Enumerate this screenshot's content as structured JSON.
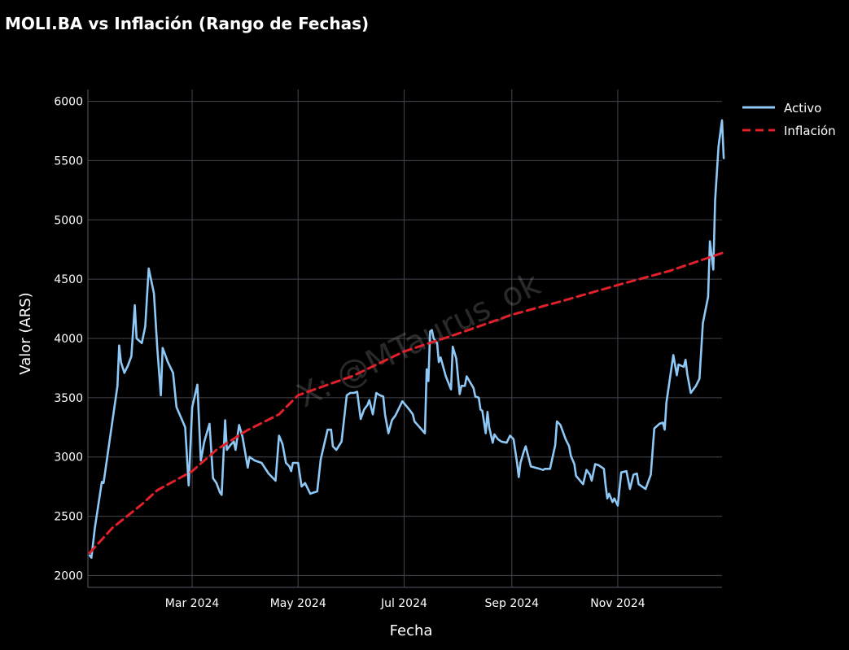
{
  "chart_data": {
    "type": "line",
    "title": "MOLI.BA vs Inflación (Rango de Fechas)",
    "xlabel": "Fecha",
    "ylabel": "Valor (ARS)",
    "xlim": [
      "2024-01-01",
      "2024-12-31"
    ],
    "ylim": [
      1900,
      6100
    ],
    "x_ticks": [
      {
        "date": "2024-03-01",
        "label": "Mar 2024"
      },
      {
        "date": "2024-05-01",
        "label": "May 2024"
      },
      {
        "date": "2024-07-01",
        "label": "Jul 2024"
      },
      {
        "date": "2024-09-01",
        "label": "Sep 2024"
      },
      {
        "date": "2024-11-01",
        "label": "Nov 2024"
      }
    ],
    "y_ticks": [
      2000,
      2500,
      3000,
      3500,
      4000,
      4500,
      5000,
      5500,
      6000
    ],
    "grid": true,
    "legend_position": "top-right",
    "watermark": "X: @MTaurus_ok",
    "series": [
      {
        "name": "Activo",
        "color": "#8ec8f6",
        "style": "solid",
        "points": [
          [
            "2024-01-02",
            2170
          ],
          [
            "2024-01-03",
            2150
          ],
          [
            "2024-01-05",
            2400
          ],
          [
            "2024-01-09",
            2790
          ],
          [
            "2024-01-10",
            2780
          ],
          [
            "2024-01-18",
            3600
          ],
          [
            "2024-01-19",
            3940
          ],
          [
            "2024-01-20",
            3800
          ],
          [
            "2024-01-22",
            3710
          ],
          [
            "2024-01-24",
            3770
          ],
          [
            "2024-01-26",
            3850
          ],
          [
            "2024-01-28",
            4280
          ],
          [
            "2024-01-29",
            4000
          ],
          [
            "2024-02-01",
            3960
          ],
          [
            "2024-02-03",
            4100
          ],
          [
            "2024-02-05",
            4590
          ],
          [
            "2024-02-08",
            4380
          ],
          [
            "2024-02-10",
            3900
          ],
          [
            "2024-02-12",
            3520
          ],
          [
            "2024-02-13",
            3920
          ],
          [
            "2024-02-16",
            3800
          ],
          [
            "2024-02-19",
            3710
          ],
          [
            "2024-02-21",
            3420
          ],
          [
            "2024-02-24",
            3320
          ],
          [
            "2024-02-26",
            3250
          ],
          [
            "2024-02-28",
            2760
          ],
          [
            "2024-03-01",
            3420
          ],
          [
            "2024-03-04",
            3610
          ],
          [
            "2024-03-06",
            2970
          ],
          [
            "2024-03-08",
            3130
          ],
          [
            "2024-03-11",
            3280
          ],
          [
            "2024-03-13",
            2820
          ],
          [
            "2024-03-15",
            2780
          ],
          [
            "2024-03-17",
            2700
          ],
          [
            "2024-03-18",
            2680
          ],
          [
            "2024-03-20",
            3310
          ],
          [
            "2024-03-21",
            3060
          ],
          [
            "2024-03-23",
            3100
          ],
          [
            "2024-03-25",
            3130
          ],
          [
            "2024-03-26",
            3060
          ],
          [
            "2024-03-28",
            3270
          ],
          [
            "2024-03-30",
            3170
          ],
          [
            "2024-04-02",
            2910
          ],
          [
            "2024-04-03",
            3000
          ],
          [
            "2024-04-06",
            2970
          ],
          [
            "2024-04-10",
            2950
          ],
          [
            "2024-04-14",
            2860
          ],
          [
            "2024-04-18",
            2800
          ],
          [
            "2024-04-20",
            3180
          ],
          [
            "2024-04-22",
            3110
          ],
          [
            "2024-04-24",
            2950
          ],
          [
            "2024-04-26",
            2920
          ],
          [
            "2024-04-27",
            2880
          ],
          [
            "2024-04-28",
            2950
          ],
          [
            "2024-05-01",
            2950
          ],
          [
            "2024-05-03",
            2750
          ],
          [
            "2024-05-05",
            2780
          ],
          [
            "2024-05-08",
            2690
          ],
          [
            "2024-05-10",
            2700
          ],
          [
            "2024-05-12",
            2710
          ],
          [
            "2024-05-14",
            2980
          ],
          [
            "2024-05-18",
            3230
          ],
          [
            "2024-05-20",
            3230
          ],
          [
            "2024-05-21",
            3090
          ],
          [
            "2024-05-23",
            3060
          ],
          [
            "2024-05-26",
            3130
          ],
          [
            "2024-05-29",
            3520
          ],
          [
            "2024-05-31",
            3540
          ],
          [
            "2024-06-02",
            3540
          ],
          [
            "2024-06-04",
            3550
          ],
          [
            "2024-06-06",
            3320
          ],
          [
            "2024-06-08",
            3400
          ],
          [
            "2024-06-10",
            3440
          ],
          [
            "2024-06-11",
            3480
          ],
          [
            "2024-06-13",
            3360
          ],
          [
            "2024-06-15",
            3540
          ],
          [
            "2024-06-17",
            3520
          ],
          [
            "2024-06-19",
            3510
          ],
          [
            "2024-06-20",
            3360
          ],
          [
            "2024-06-22",
            3200
          ],
          [
            "2024-06-24",
            3310
          ],
          [
            "2024-06-26",
            3350
          ],
          [
            "2024-06-30",
            3470
          ],
          [
            "2024-07-04",
            3400
          ],
          [
            "2024-07-06",
            3360
          ],
          [
            "2024-07-07",
            3300
          ],
          [
            "2024-07-10",
            3250
          ],
          [
            "2024-07-13",
            3200
          ],
          [
            "2024-07-14",
            3740
          ],
          [
            "2024-07-15",
            3640
          ],
          [
            "2024-07-16",
            4060
          ],
          [
            "2024-07-17",
            4070
          ],
          [
            "2024-07-18",
            4000
          ],
          [
            "2024-07-20",
            3960
          ],
          [
            "2024-07-21",
            3800
          ],
          [
            "2024-07-22",
            3840
          ],
          [
            "2024-07-25",
            3680
          ],
          [
            "2024-07-28",
            3570
          ],
          [
            "2024-07-29",
            3930
          ],
          [
            "2024-07-31",
            3830
          ],
          [
            "2024-08-02",
            3530
          ],
          [
            "2024-08-03",
            3600
          ],
          [
            "2024-08-05",
            3600
          ],
          [
            "2024-08-06",
            3680
          ],
          [
            "2024-08-08",
            3630
          ],
          [
            "2024-08-10",
            3580
          ],
          [
            "2024-08-11",
            3510
          ],
          [
            "2024-08-13",
            3500
          ],
          [
            "2024-08-14",
            3400
          ],
          [
            "2024-08-15",
            3390
          ],
          [
            "2024-08-17",
            3200
          ],
          [
            "2024-08-18",
            3380
          ],
          [
            "2024-08-19",
            3250
          ],
          [
            "2024-08-21",
            3120
          ],
          [
            "2024-08-22",
            3190
          ],
          [
            "2024-08-24",
            3150
          ],
          [
            "2024-08-26",
            3130
          ],
          [
            "2024-08-29",
            3120
          ],
          [
            "2024-08-31",
            3180
          ],
          [
            "2024-09-02",
            3150
          ],
          [
            "2024-09-04",
            2950
          ],
          [
            "2024-09-05",
            2830
          ],
          [
            "2024-09-06",
            2950
          ],
          [
            "2024-09-08",
            3050
          ],
          [
            "2024-09-09",
            3090
          ],
          [
            "2024-09-12",
            2920
          ],
          [
            "2024-09-17",
            2900
          ],
          [
            "2024-09-19",
            2890
          ],
          [
            "2024-09-20",
            2900
          ],
          [
            "2024-09-23",
            2900
          ],
          [
            "2024-09-26",
            3100
          ],
          [
            "2024-09-27",
            3300
          ],
          [
            "2024-09-29",
            3270
          ],
          [
            "2024-09-30",
            3230
          ],
          [
            "2024-10-02",
            3150
          ],
          [
            "2024-10-04",
            3090
          ],
          [
            "2024-10-05",
            3010
          ],
          [
            "2024-10-07",
            2940
          ],
          [
            "2024-10-08",
            2840
          ],
          [
            "2024-10-12",
            2770
          ],
          [
            "2024-10-14",
            2890
          ],
          [
            "2024-10-16",
            2850
          ],
          [
            "2024-10-17",
            2800
          ],
          [
            "2024-10-19",
            2940
          ],
          [
            "2024-10-21",
            2930
          ],
          [
            "2024-10-24",
            2900
          ],
          [
            "2024-10-25",
            2760
          ],
          [
            "2024-10-26",
            2650
          ],
          [
            "2024-10-27",
            2690
          ],
          [
            "2024-10-29",
            2620
          ],
          [
            "2024-10-30",
            2650
          ],
          [
            "2024-11-01",
            2590
          ],
          [
            "2024-11-03",
            2870
          ],
          [
            "2024-11-06",
            2880
          ],
          [
            "2024-11-08",
            2730
          ],
          [
            "2024-11-10",
            2850
          ],
          [
            "2024-11-12",
            2860
          ],
          [
            "2024-11-13",
            2770
          ],
          [
            "2024-11-17",
            2730
          ],
          [
            "2024-11-20",
            2850
          ],
          [
            "2024-11-22",
            3240
          ],
          [
            "2024-11-25",
            3280
          ],
          [
            "2024-11-27",
            3290
          ],
          [
            "2024-11-28",
            3230
          ],
          [
            "2024-11-29",
            3460
          ],
          [
            "2024-12-03",
            3860
          ],
          [
            "2024-12-05",
            3690
          ],
          [
            "2024-12-06",
            3780
          ],
          [
            "2024-12-09",
            3760
          ],
          [
            "2024-12-10",
            3820
          ],
          [
            "2024-12-11",
            3700
          ],
          [
            "2024-12-13",
            3540
          ],
          [
            "2024-12-16",
            3600
          ],
          [
            "2024-12-18",
            3660
          ],
          [
            "2024-12-20",
            4130
          ],
          [
            "2024-12-23",
            4350
          ],
          [
            "2024-12-24",
            4820
          ],
          [
            "2024-12-26",
            4580
          ],
          [
            "2024-12-27",
            5160
          ],
          [
            "2024-12-29",
            5620
          ],
          [
            "2024-12-31",
            5840
          ],
          [
            "2025-01-01",
            5520
          ]
        ]
      },
      {
        "name": "Inflación",
        "color": "#e0202a",
        "style": "dashed",
        "points": [
          [
            "2024-01-02",
            2190
          ],
          [
            "2024-01-15",
            2400
          ],
          [
            "2024-02-01",
            2600
          ],
          [
            "2024-02-10",
            2720
          ],
          [
            "2024-03-01",
            2880
          ],
          [
            "2024-03-15",
            3060
          ],
          [
            "2024-04-01",
            3220
          ],
          [
            "2024-04-20",
            3360
          ],
          [
            "2024-05-01",
            3520
          ],
          [
            "2024-05-20",
            3620
          ],
          [
            "2024-06-01",
            3680
          ],
          [
            "2024-07-01",
            3890
          ],
          [
            "2024-08-01",
            4040
          ],
          [
            "2024-09-01",
            4200
          ],
          [
            "2024-10-01",
            4320
          ],
          [
            "2024-11-01",
            4450
          ],
          [
            "2024-12-01",
            4570
          ],
          [
            "2024-12-31",
            4720
          ]
        ]
      }
    ]
  }
}
